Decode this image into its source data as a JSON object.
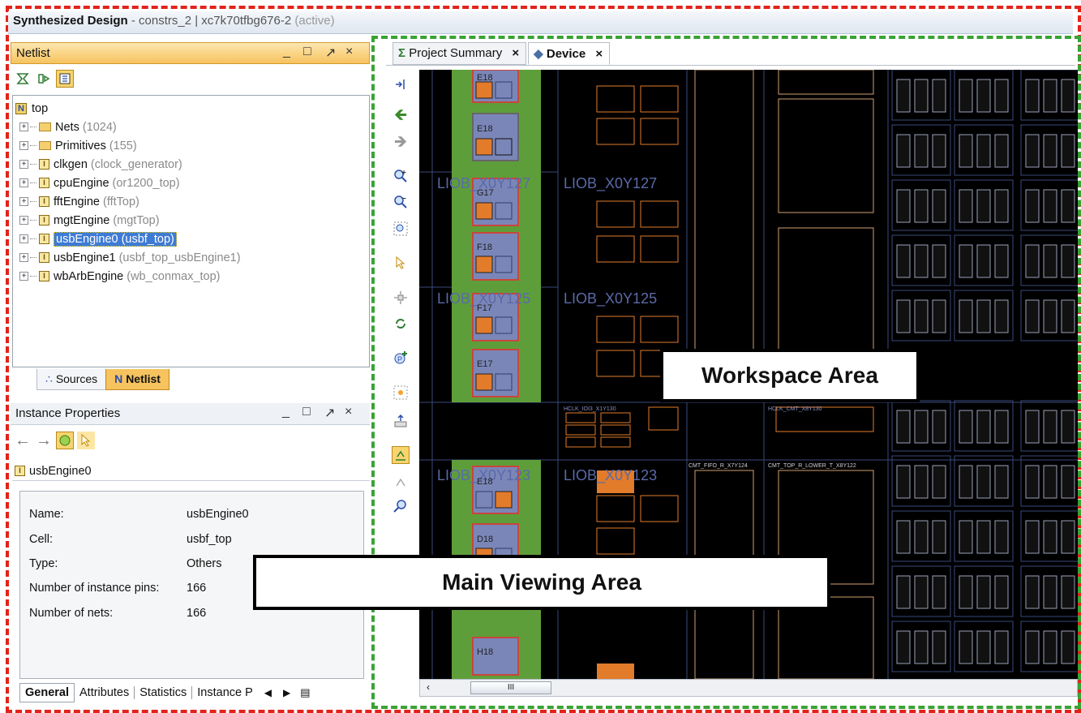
{
  "window": {
    "title_bold": "Synthesized Design",
    "title_rest": " - constrs_2 | xc7k70tfbg676-2",
    "title_state": " (active)"
  },
  "netlist_pane": {
    "title": "Netlist",
    "controls": [
      "_",
      "□",
      "↗",
      "×"
    ],
    "toolbar": [
      "collapse-all-icon",
      "expand-all-icon",
      "show-hierarchy-icon"
    ],
    "tree": {
      "root": "top",
      "items": [
        {
          "name": "Nets",
          "detail": "(1024)",
          "kind": "folder"
        },
        {
          "name": "Primitives",
          "detail": "(155)",
          "kind": "folder"
        },
        {
          "name": "clkgen",
          "detail": "(clock_generator)",
          "kind": "instance"
        },
        {
          "name": "cpuEngine",
          "detail": "(or1200_top)",
          "kind": "instance"
        },
        {
          "name": "fftEngine",
          "detail": "(fftTop)",
          "kind": "instance"
        },
        {
          "name": "mgtEngine",
          "detail": "(mgtTop)",
          "kind": "instance"
        },
        {
          "name": "usbEngine0",
          "detail": "(usbf_top)",
          "kind": "instance",
          "selected": true
        },
        {
          "name": "usbEngine1",
          "detail": "(usbf_top_usbEngine1)",
          "kind": "instance"
        },
        {
          "name": "wbArbEngine",
          "detail": "(wb_conmax_top)",
          "kind": "instance"
        }
      ]
    },
    "tabs": [
      {
        "label": "Sources",
        "active": false
      },
      {
        "label": "Netlist",
        "active": true
      }
    ]
  },
  "properties_pane": {
    "title": "Instance Properties",
    "controls": [
      "_",
      "□",
      "↗",
      "×"
    ],
    "instance_name": "usbEngine0",
    "rows": [
      {
        "label": "Name:",
        "value": "usbEngine0"
      },
      {
        "label": "Cell:",
        "value": "usbf_top"
      },
      {
        "label": "Type:",
        "value": "Others"
      },
      {
        "label": "Number of instance pins:",
        "value": "166"
      },
      {
        "label": "Number of nets:",
        "value": "166"
      }
    ],
    "tabs": [
      "General",
      "Attributes",
      "Statistics",
      "Instance P"
    ]
  },
  "editor": {
    "tabs": [
      {
        "label": "Project Summary",
        "icon": "sigma-icon",
        "active": false
      },
      {
        "label": "Device",
        "icon": "device-icon",
        "active": true
      }
    ],
    "close_glyph": "×",
    "scroll_thumb": "III"
  },
  "device_view": {
    "site_labels": [
      "LIOB_X0Y127",
      "LIOB_X0Y125",
      "LIOB_X0Y123"
    ],
    "pad_labels": [
      "E18",
      "G17",
      "F18",
      "F17",
      "E17",
      "E18",
      "D18",
      "H18"
    ],
    "clock_labels": [
      "HCLK_IOI3_X1Y130",
      "HCLK_CMT_X8Y130"
    ],
    "cmt_labels": [
      "CMT_FIFO_R_X7Y124",
      "CMT_TOP_R_LOWER_T_X8Y122"
    ],
    "colors": {
      "background": "#000000",
      "pad_column": "#5e9e3a",
      "selected_site": "#e27b2a",
      "grid_lines": "#3a4a7a"
    }
  },
  "callouts": {
    "workspace": "Workspace Area",
    "viewing": "Main Viewing Area"
  }
}
